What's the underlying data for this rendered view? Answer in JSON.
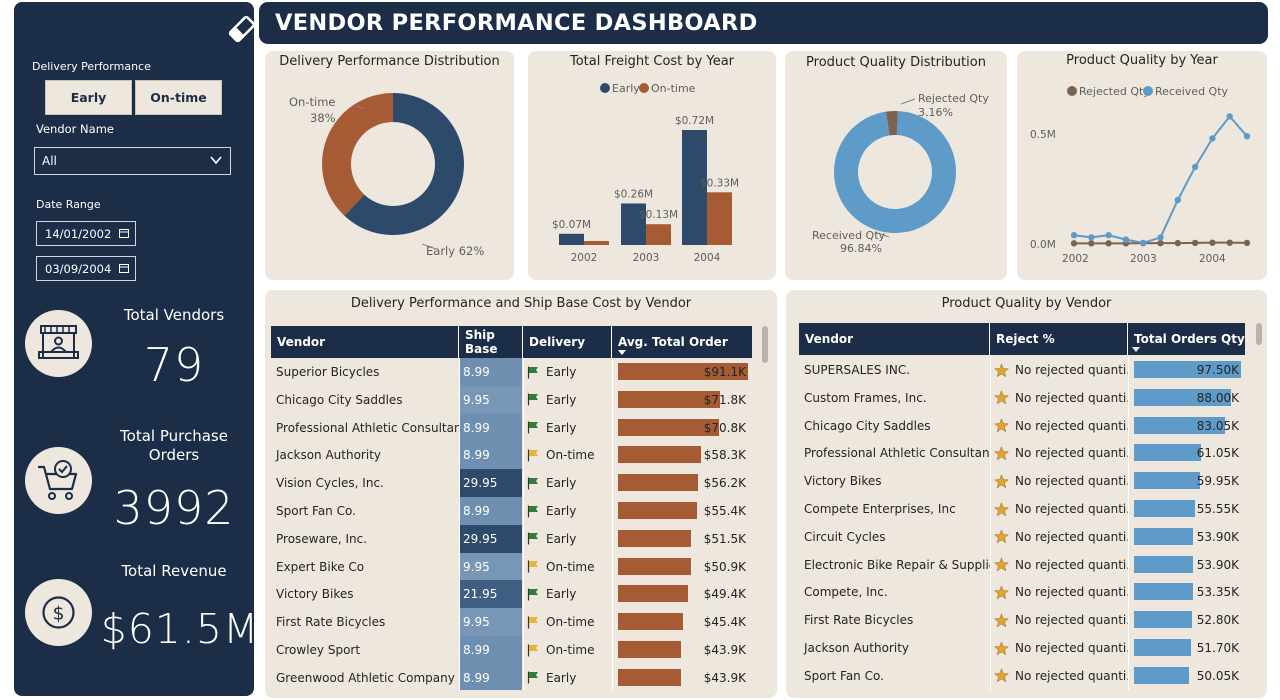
{
  "colors": {
    "navy": "#1c2d48",
    "cream": "#ede7dd",
    "early": "#2e4a6b",
    "ontime": "#a65b34",
    "received": "#5e9bc8",
    "rejected": "#7b6354",
    "ship_dark": "#2e4a6b",
    "ship_light": "#6f8fb0",
    "flag_green": "#2f7d3a",
    "flag_yellow": "#e5b53a",
    "star": "#e5a32c"
  },
  "sidebar": {
    "eraser_icon": "eraser-icon",
    "delivery_label": "Delivery Performance",
    "delivery_options": [
      "Early",
      "On-time"
    ],
    "vendor_label": "Vendor Name",
    "vendor_value": "All",
    "date_label": "Date Range",
    "date_start": "14/01/2002",
    "date_end": "03/09/2004",
    "kpis": [
      {
        "title": "Total Vendors",
        "value": "79",
        "icon": "vendor-stall-icon"
      },
      {
        "title": "Total Purchase Orders",
        "value": "3992",
        "icon": "shopping-cart-check-icon"
      },
      {
        "title": "Total Revenue",
        "value": "$61.5M",
        "icon": "dollar-coin-icon"
      }
    ]
  },
  "header": {
    "title": "VENDOR PERFORMANCE DASHBOARD"
  },
  "cards": {
    "delivery_dist": {
      "title": "Delivery Performance Distribution"
    },
    "freight": {
      "title": "Total Freight Cost by Year"
    },
    "quality_dist": {
      "title": "Product Quality Distribution"
    },
    "quality_year": {
      "title": "Product Quality by Year"
    },
    "ship_table": {
      "title": "Delivery Performance and Ship Base Cost by Vendor"
    },
    "quality_table": {
      "title": "Product Quality by Vendor"
    }
  },
  "chart_data": [
    {
      "type": "pie",
      "title": "Delivery Performance Distribution",
      "donut": true,
      "slices": [
        {
          "label": "Early",
          "value": 62,
          "display": "Early 62%"
        },
        {
          "label": "On-time",
          "value": 38,
          "display_name": "On-time",
          "display_pct": "38%"
        }
      ]
    },
    {
      "type": "bar",
      "title": "Total Freight Cost by Year",
      "legend": "top",
      "categories": [
        "2002",
        "2003",
        "2004"
      ],
      "series": [
        {
          "name": "Early",
          "values": [
            0.07,
            0.26,
            0.72
          ],
          "labels": [
            "$0.07M",
            "$0.26M",
            "$0.72M"
          ]
        },
        {
          "name": "On-time",
          "values": [
            0.025,
            0.13,
            0.33
          ],
          "labels": [
            "",
            "$0.13M",
            "$0.33M"
          ]
        }
      ]
    },
    {
      "type": "pie",
      "title": "Product Quality Distribution",
      "donut": true,
      "slices": [
        {
          "label": "Received Qty",
          "value": 96.84,
          "display_name": "Received Qty",
          "display_pct": "96.84%"
        },
        {
          "label": "Rejected Qty",
          "value": 3.16,
          "display_name": "Rejected Qty",
          "display_pct": "3.16%"
        }
      ]
    },
    {
      "type": "line",
      "title": "Product Quality by Year",
      "legend": "top",
      "x_ticks": [
        "2002",
        "2003",
        "2004"
      ],
      "y_ticks": [
        "0.5M",
        "0.0M"
      ],
      "ylim": [
        0,
        0.6
      ],
      "x": [
        "2002-01",
        "2002-04",
        "2002-07",
        "2002-10",
        "2003-01",
        "2003-04",
        "2003-07",
        "2003-10",
        "2004-01",
        "2004-04",
        "2004-07"
      ],
      "series": [
        {
          "name": "Rejected Qty",
          "values": [
            0.003,
            0.003,
            0.003,
            0.003,
            0.004,
            0.004,
            0.004,
            0.005,
            0.006,
            0.006,
            0.005
          ]
        },
        {
          "name": "Received Qty",
          "values": [
            0.04,
            0.03,
            0.04,
            0.02,
            0.005,
            0.03,
            0.2,
            0.35,
            0.48,
            0.58,
            0.49
          ]
        }
      ]
    }
  ],
  "ship_table": {
    "headers": [
      "Vendor",
      "Ship Base",
      "Delivery",
      "Avg. Total Order"
    ],
    "rows": [
      {
        "vendor": "Superior Bicycles",
        "ship": "8.99",
        "delivery": "Early",
        "avg": 91.1,
        "avg_label": "$91.1K"
      },
      {
        "vendor": "Chicago City Saddles",
        "ship": "9.95",
        "delivery": "Early",
        "avg": 71.8,
        "avg_label": "$71.8K"
      },
      {
        "vendor": "Professional Athletic Consultants",
        "ship": "8.99",
        "delivery": "Early",
        "avg": 70.8,
        "avg_label": "$70.8K"
      },
      {
        "vendor": "Jackson Authority",
        "ship": "8.99",
        "delivery": "On-time",
        "avg": 58.3,
        "avg_label": "$58.3K"
      },
      {
        "vendor": "Vision Cycles, Inc.",
        "ship": "29.95",
        "delivery": "Early",
        "avg": 56.2,
        "avg_label": "$56.2K"
      },
      {
        "vendor": "Sport Fan Co.",
        "ship": "8.99",
        "delivery": "Early",
        "avg": 55.4,
        "avg_label": "$55.4K"
      },
      {
        "vendor": "Proseware, Inc.",
        "ship": "29.95",
        "delivery": "Early",
        "avg": 51.5,
        "avg_label": "$51.5K"
      },
      {
        "vendor": "Expert Bike Co",
        "ship": "9.95",
        "delivery": "On-time",
        "avg": 50.9,
        "avg_label": "$50.9K"
      },
      {
        "vendor": "Victory Bikes",
        "ship": "21.95",
        "delivery": "Early",
        "avg": 49.4,
        "avg_label": "$49.4K"
      },
      {
        "vendor": "First Rate Bicycles",
        "ship": "9.95",
        "delivery": "On-time",
        "avg": 45.4,
        "avg_label": "$45.4K"
      },
      {
        "vendor": "Crowley Sport",
        "ship": "8.99",
        "delivery": "On-time",
        "avg": 43.9,
        "avg_label": "$43.9K"
      },
      {
        "vendor": "Greenwood Athletic Company",
        "ship": "8.99",
        "delivery": "Early",
        "avg": 43.9,
        "avg_label": "$43.9K"
      }
    ]
  },
  "quality_table": {
    "headers": [
      "Vendor",
      "Reject %",
      "Total Orders Qty"
    ],
    "rows": [
      {
        "vendor": "SUPERSALES INC.",
        "reject": "No rejected quanti...",
        "qty": 97.5,
        "qty_label": "97.50K"
      },
      {
        "vendor": "Custom Frames, Inc.",
        "reject": "No rejected quanti...",
        "qty": 88.0,
        "qty_label": "88.00K"
      },
      {
        "vendor": "Chicago City Saddles",
        "reject": "No rejected quanti...",
        "qty": 83.05,
        "qty_label": "83.05K"
      },
      {
        "vendor": "Professional Athletic Consultants",
        "reject": "No rejected quanti...",
        "qty": 61.05,
        "qty_label": "61.05K"
      },
      {
        "vendor": "Victory Bikes",
        "reject": "No rejected quanti...",
        "qty": 59.95,
        "qty_label": "59.95K"
      },
      {
        "vendor": "Compete Enterprises, Inc",
        "reject": "No rejected quanti...",
        "qty": 55.55,
        "qty_label": "55.55K"
      },
      {
        "vendor": "Circuit Cycles",
        "reject": "No rejected quanti...",
        "qty": 53.9,
        "qty_label": "53.90K"
      },
      {
        "vendor": "Electronic Bike Repair & Supplies",
        "reject": "No rejected quanti...",
        "qty": 53.9,
        "qty_label": "53.90K"
      },
      {
        "vendor": "Compete, Inc.",
        "reject": "No rejected quanti...",
        "qty": 53.35,
        "qty_label": "53.35K"
      },
      {
        "vendor": "First Rate Bicycles",
        "reject": "No rejected quanti...",
        "qty": 52.8,
        "qty_label": "52.80K"
      },
      {
        "vendor": "Jackson Authority",
        "reject": "No rejected quanti...",
        "qty": 51.7,
        "qty_label": "51.70K"
      },
      {
        "vendor": "Sport Fan Co.",
        "reject": "No rejected quanti...",
        "qty": 50.05,
        "qty_label": "50.05K"
      }
    ]
  }
}
